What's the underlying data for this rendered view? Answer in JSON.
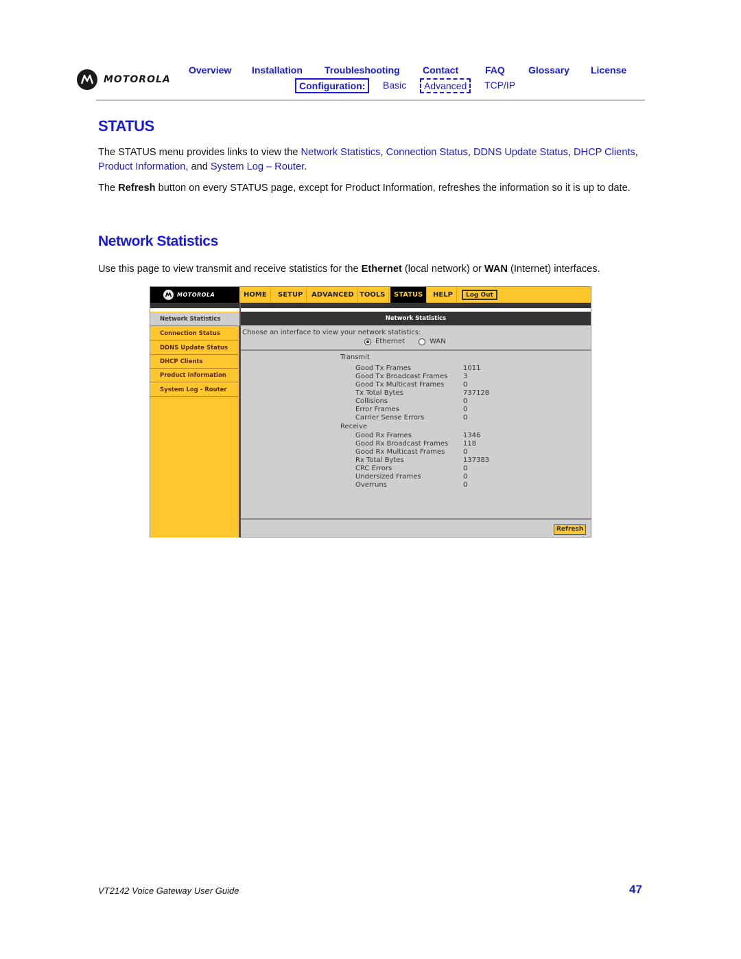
{
  "header": {
    "brand": "MOTOROLA",
    "nav": [
      {
        "label": "Overview"
      },
      {
        "label": "Installation"
      },
      {
        "label": "Troubleshooting"
      },
      {
        "label": "Contact"
      },
      {
        "label": "FAQ"
      },
      {
        "label": "Glossary"
      },
      {
        "label": "License"
      }
    ],
    "config_label": "Configuration:",
    "config_links": [
      {
        "label": "Basic"
      },
      {
        "label": "Advanced"
      },
      {
        "label": "TCP/IP"
      }
    ]
  },
  "content": {
    "title": "STATUS",
    "p1": {
      "pre": "The STATUS menu provides links to view the ",
      "links": [
        "Network Statistics",
        "Connection Status",
        "DDNS Update Status",
        "DHCP Clients",
        "Product Information",
        "System Log – Router"
      ],
      "sep": ", ",
      "and": ", and ",
      "end": "."
    },
    "p2": {
      "pre": "The ",
      "bold": "Refresh",
      "post": " button on every STATUS page, except for Product Information, refreshes the information so it is up to date."
    },
    "section_title": "Network Statistics",
    "p3": {
      "pre": "Use this page to view transmit and receive statistics for the ",
      "bold1": "Ethernet",
      "mid": " (local network) or ",
      "bold2": "WAN",
      "post": " (Internet) interfaces."
    }
  },
  "router_ui": {
    "brand": "MOTOROLA",
    "tabs": [
      {
        "label": "HOME"
      },
      {
        "label": "SETUP"
      },
      {
        "label": "ADVANCED"
      },
      {
        "label": "TOOLS"
      },
      {
        "label": "STATUS",
        "active": true
      },
      {
        "label": "HELP"
      }
    ],
    "logout_label": "Log Out",
    "sidebar": [
      {
        "label": "Network Statistics",
        "active": true
      },
      {
        "label": "Connection Status"
      },
      {
        "label": "DDNS Update Status"
      },
      {
        "label": "DHCP Clients"
      },
      {
        "label": "Product Information"
      },
      {
        "label": "System Log - Router"
      }
    ],
    "panel_title": "Network Statistics",
    "choose_label": "Choose an interface to view your network statistics:",
    "interfaces": [
      {
        "label": "Ethernet",
        "selected": true
      },
      {
        "label": "WAN",
        "selected": false
      }
    ],
    "transmit": {
      "heading": "Transmit",
      "rows": [
        {
          "label": "Good Tx Frames",
          "value": "1011"
        },
        {
          "label": "Good Tx Broadcast Frames",
          "value": "3"
        },
        {
          "label": "Good Tx Multicast Frames",
          "value": "0"
        },
        {
          "label": "Tx Total Bytes",
          "value": "737128"
        },
        {
          "label": "Collisions",
          "value": "0"
        },
        {
          "label": "Error Frames",
          "value": "0"
        },
        {
          "label": "Carrier Sense Errors",
          "value": "0"
        }
      ]
    },
    "receive": {
      "heading": "Receive",
      "rows": [
        {
          "label": "Good Rx Frames",
          "value": "1346"
        },
        {
          "label": "Good Rx Broadcast Frames",
          "value": "118"
        },
        {
          "label": "Good Rx Multicast Frames",
          "value": "0"
        },
        {
          "label": "Rx Total Bytes",
          "value": "137383"
        },
        {
          "label": "CRC Errors",
          "value": "0"
        },
        {
          "label": "Undersized Frames",
          "value": "0"
        },
        {
          "label": "Overruns",
          "value": "0"
        }
      ]
    },
    "refresh_label": "Refresh"
  },
  "footer": {
    "title": "VT2142 Voice Gateway User Guide",
    "page_number": "47"
  },
  "colors": {
    "link_blue": "#1a1adb",
    "router_yellow": "#fec72e",
    "router_dark": "#333333",
    "router_gray": "#cfcfcf"
  }
}
